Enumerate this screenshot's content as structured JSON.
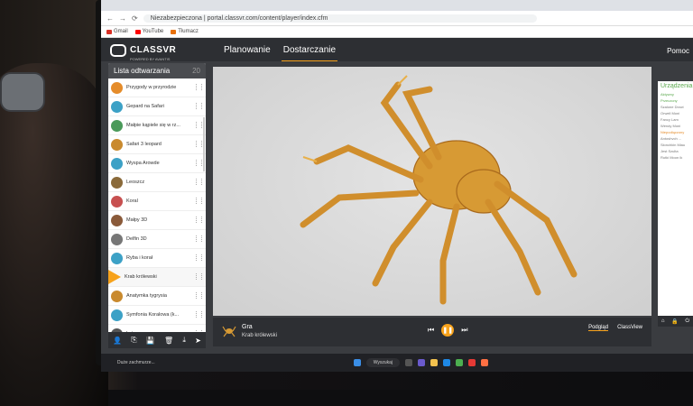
{
  "browser": {
    "address": "portal.classvr.com/content/player/index.cfm",
    "address_prefix": "Niezabezpieczona",
    "bookmarks": [
      "Gmail",
      "YouTube",
      "Tłumacz"
    ]
  },
  "app": {
    "logo": "CLASSVR",
    "logo_sub": "POWERED BY AVANTIS",
    "tabs": [
      "Planowanie",
      "Dostarczanie"
    ],
    "active_tab": 1,
    "help": "Pomoc"
  },
  "playlist": {
    "title": "Lista odtwarzania",
    "count": "20",
    "items": [
      {
        "title": "Przygody w przyrodzie",
        "color": "#e58c2a"
      },
      {
        "title": "Gepard na Safari",
        "color": "#3ca1c6"
      },
      {
        "title": "Małpie kąpiele się w rz...",
        "color": "#4a9a5a"
      },
      {
        "title": "Safari 3 leopard",
        "color": "#c98a2e"
      },
      {
        "title": "Wyspa Arowde",
        "color": "#3ca1c6"
      },
      {
        "title": "Leoszcz",
        "color": "#8a6a3a"
      },
      {
        "title": "Koral",
        "color": "#c75050"
      },
      {
        "title": "Małpy 3D",
        "color": "#8a5a3a"
      },
      {
        "title": "Delfin 3D",
        "color": "#777"
      },
      {
        "title": "Ryba i korał",
        "color": "#3ca1c6"
      },
      {
        "title": "Krab królewski",
        "color": "#f7a21b",
        "playing": true
      },
      {
        "title": "Anatymka tygrysia",
        "color": "#c98a2e"
      },
      {
        "title": "Symfonia Koralowa (k...",
        "color": "#3ca1c6"
      },
      {
        "title": "Lstor",
        "color": "#555"
      }
    ]
  },
  "right_panel": {
    "title": "Urządzenia",
    "items": [
      "Aktywny",
      "Przeczony",
      "Szalone Drzwi",
      "Orwell Moni",
      "Fancy Lam",
      "Wendy Moni",
      "Niepodłączony",
      "Antoshvch ...",
      "Słonchkin Miau",
      "Jest Szulta",
      "Rutki Moon ik"
    ]
  },
  "player": {
    "label": "Gra",
    "name": "Krab królewski",
    "modes": [
      "Podgląd",
      "ClassView"
    ]
  },
  "taskbar": {
    "weather": "Duże zachmurze...",
    "search": "Wyszukaj"
  }
}
